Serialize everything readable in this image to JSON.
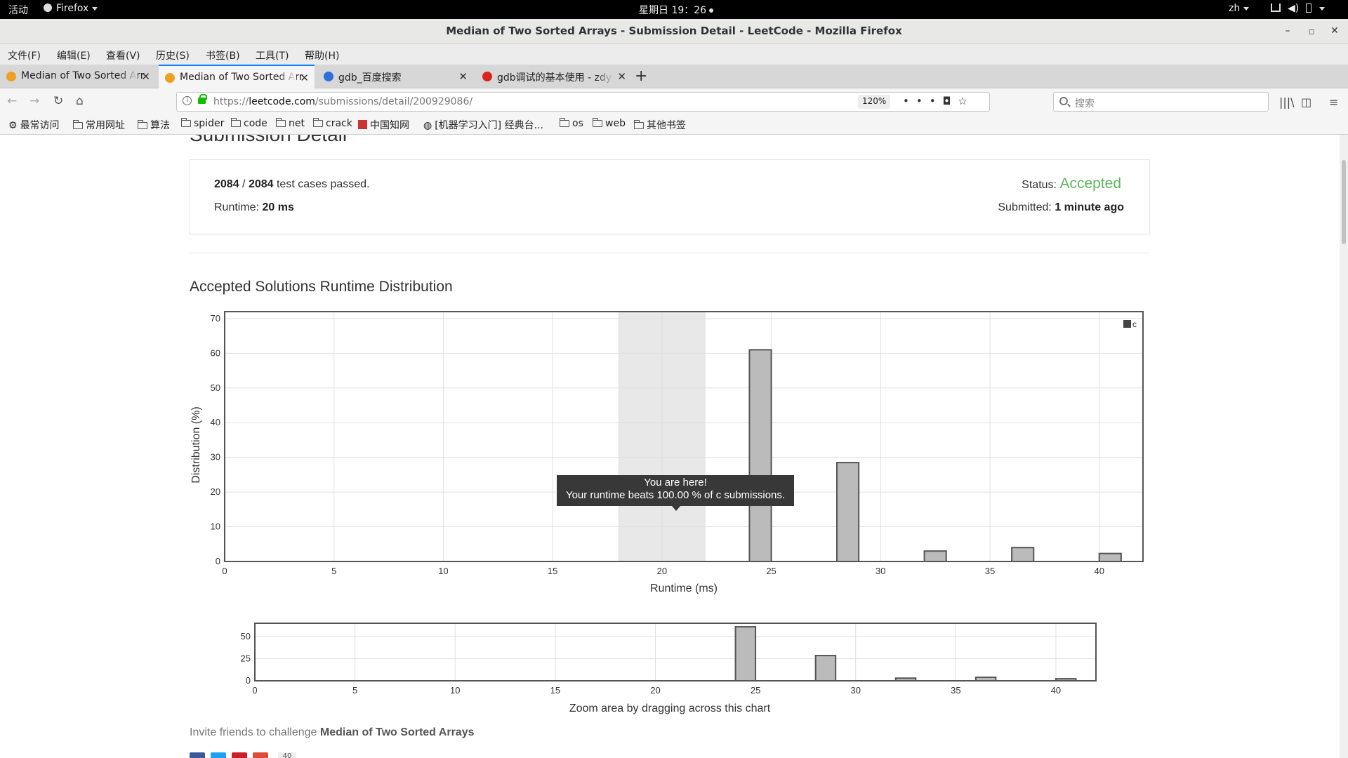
{
  "topbar": {
    "activities": "活动",
    "app": "Firefox",
    "clock": "星期日 19：26",
    "lang": "zh"
  },
  "window": {
    "title": "Median of Two Sorted Arrays - Submission Detail - LeetCode - Mozilla Firefox"
  },
  "menu": [
    "文件(F)",
    "编辑(E)",
    "查看(V)",
    "历史(S)",
    "书签(B)",
    "工具(T)",
    "帮助(H)"
  ],
  "tabs": [
    {
      "label": "Median of Two Sorted Arr",
      "icon_color": "#f0a020",
      "active": false
    },
    {
      "label": "Median of Two Sorted Arr",
      "icon_color": "#f0a020",
      "active": true
    },
    {
      "label": "gdb_百度搜索",
      "icon_color": "#2f6fdb",
      "active": false
    },
    {
      "label": "gdb调试的基本使用 - zdy",
      "icon_color": "#d9261c",
      "active": false
    }
  ],
  "nav": {
    "url_prefix": "https://",
    "url_domain": "leetcode.com",
    "url_path": "/submissions/detail/200929086/",
    "zoom": "120%",
    "search_placeholder": "搜索"
  },
  "bookmarks": [
    "最常访问",
    "常用网址",
    "算法",
    "spider",
    "code",
    "net",
    "crack",
    "中国知网",
    "[机器学习入门] 经典台...",
    "os",
    "web",
    "其他书签"
  ],
  "page": {
    "title": "Submission Detail",
    "passed": "2084",
    "total": "2084",
    "passed_suffix": "test cases passed.",
    "runtime_label": "Runtime:",
    "runtime_value": "20 ms",
    "status_label": "Status:",
    "status_value": "Accepted",
    "submitted_label": "Submitted:",
    "submitted_value": "1 minute ago",
    "distribution_title": "Accepted Solutions Runtime Distribution",
    "invite_prefix": "Invite friends to challenge",
    "invite_problem": "Median of Two Sorted Arrays",
    "share_count": "40"
  },
  "tooltip": {
    "line1": "You are here!",
    "line2": "Your runtime beats 100.00 % of c submissions."
  },
  "colors": {
    "accepted": "#5cb85c",
    "bar_fill": "#bbbbbb",
    "bar_stroke": "#555555",
    "highlight_band": "#e8e8e8"
  },
  "chart_data": [
    {
      "type": "bar",
      "title": "",
      "xlabel": "Runtime (ms)",
      "ylabel": "Distribution (%)",
      "xlim": [
        0,
        42
      ],
      "ylim": [
        0,
        72
      ],
      "xticks": [
        0,
        5,
        10,
        15,
        20,
        25,
        30,
        35,
        40
      ],
      "yticks": [
        0,
        10,
        20,
        30,
        40,
        50,
        60,
        70
      ],
      "highlight_range": [
        18,
        22
      ],
      "legend": {
        "position": "top-right",
        "entries": [
          "c"
        ]
      },
      "series": [
        {
          "name": "c",
          "x": [
            24.5,
            28.5,
            32.5,
            36.5,
            40.5
          ],
          "values": [
            61,
            28.5,
            3,
            4,
            2.3
          ]
        }
      ],
      "grid": true
    },
    {
      "type": "bar",
      "title": "",
      "xlabel": "Zoom area by dragging across this chart",
      "xlim": [
        0,
        42
      ],
      "ylim": [
        0,
        65
      ],
      "xticks": [
        0,
        5,
        10,
        15,
        20,
        25,
        30,
        35,
        40
      ],
      "yticks": [
        0,
        25,
        50
      ],
      "series": [
        {
          "x": [
            24.5,
            28.5,
            32.5,
            36.5,
            40.5
          ],
          "values": [
            61,
            28.5,
            3,
            4,
            2.3
          ]
        }
      ],
      "grid": true
    }
  ]
}
